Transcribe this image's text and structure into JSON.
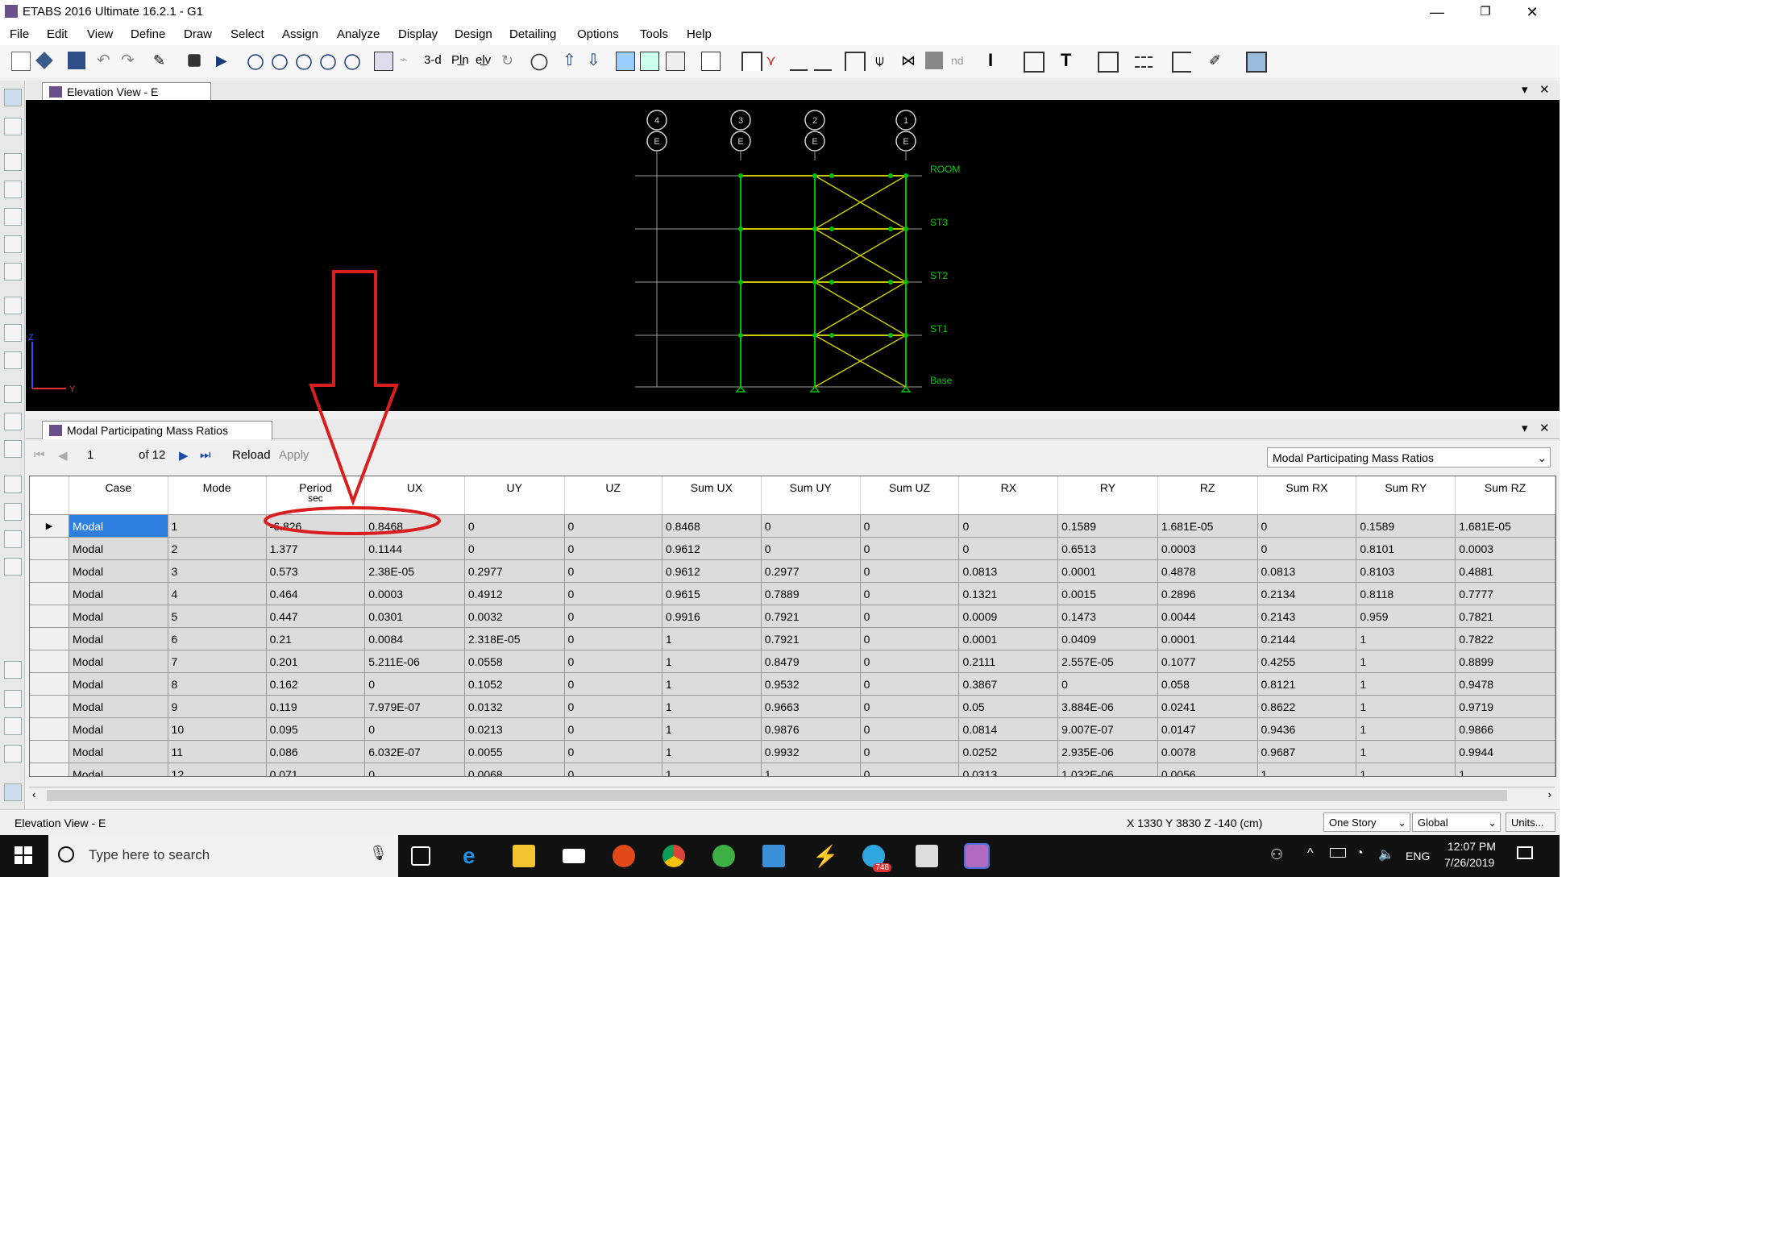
{
  "window": {
    "title": "ETABS 2016 Ultimate 16.2.1 - G1",
    "minimize": "—",
    "restore": "❐",
    "close": "✕"
  },
  "menu": [
    "File",
    "Edit",
    "View",
    "Define",
    "Draw",
    "Select",
    "Assign",
    "Analyze",
    "Display",
    "Design",
    "Detailing",
    "Options",
    "Tools",
    "Help"
  ],
  "toolbar": {
    "view3d_label": "3-d",
    "plan_label": "Pl̲n",
    "elev_label": "el̲v",
    "nd_label": "nd"
  },
  "elevation_panel": {
    "tab_label": "Elevation View - E",
    "grid_labels": [
      "4",
      "3",
      "2",
      "1"
    ],
    "grid_line_label": "E",
    "stories": [
      "ROOM",
      "ST3",
      "ST2",
      "ST1",
      "Base"
    ],
    "axis_z": "Z",
    "axis_y": "Y"
  },
  "table_panel": {
    "tab_label": "Modal Participating Mass Ratios",
    "nav": {
      "page": "1",
      "of_label": "of 12",
      "reload": "Reload",
      "apply": "Apply"
    },
    "table_select": "Modal Participating Mass Ratios",
    "columns": [
      {
        "label": "Case",
        "sub": ""
      },
      {
        "label": "Mode",
        "sub": ""
      },
      {
        "label": "Period",
        "sub": "sec"
      },
      {
        "label": "UX",
        "sub": ""
      },
      {
        "label": "UY",
        "sub": ""
      },
      {
        "label": "UZ",
        "sub": ""
      },
      {
        "label": "Sum UX",
        "sub": ""
      },
      {
        "label": "Sum UY",
        "sub": ""
      },
      {
        "label": "Sum UZ",
        "sub": ""
      },
      {
        "label": "RX",
        "sub": ""
      },
      {
        "label": "RY",
        "sub": ""
      },
      {
        "label": "RZ",
        "sub": ""
      },
      {
        "label": "Sum RX",
        "sub": ""
      },
      {
        "label": "Sum RY",
        "sub": ""
      },
      {
        "label": "Sum RZ",
        "sub": ""
      }
    ],
    "rows": [
      [
        "Modal",
        "1",
        "-6.826",
        "0.8468",
        "0",
        "0",
        "0.8468",
        "0",
        "0",
        "0",
        "0.1589",
        "1.681E-05",
        "0",
        "0.1589",
        "1.681E-05"
      ],
      [
        "Modal",
        "2",
        "1.377",
        "0.1144",
        "0",
        "0",
        "0.9612",
        "0",
        "0",
        "0",
        "0.6513",
        "0.0003",
        "0",
        "0.8101",
        "0.0003"
      ],
      [
        "Modal",
        "3",
        "0.573",
        "2.38E-05",
        "0.2977",
        "0",
        "0.9612",
        "0.2977",
        "0",
        "0.0813",
        "0.0001",
        "0.4878",
        "0.0813",
        "0.8103",
        "0.4881"
      ],
      [
        "Modal",
        "4",
        "0.464",
        "0.0003",
        "0.4912",
        "0",
        "0.9615",
        "0.7889",
        "0",
        "0.1321",
        "0.0015",
        "0.2896",
        "0.2134",
        "0.8118",
        "0.7777"
      ],
      [
        "Modal",
        "5",
        "0.447",
        "0.0301",
        "0.0032",
        "0",
        "0.9916",
        "0.7921",
        "0",
        "0.0009",
        "0.1473",
        "0.0044",
        "0.2143",
        "0.959",
        "0.7821"
      ],
      [
        "Modal",
        "6",
        "0.21",
        "0.0084",
        "2.318E-05",
        "0",
        "1",
        "0.7921",
        "0",
        "0.0001",
        "0.0409",
        "0.0001",
        "0.2144",
        "1",
        "0.7822"
      ],
      [
        "Modal",
        "7",
        "0.201",
        "5.211E-06",
        "0.0558",
        "0",
        "1",
        "0.8479",
        "0",
        "0.2111",
        "2.557E-05",
        "0.1077",
        "0.4255",
        "1",
        "0.8899"
      ],
      [
        "Modal",
        "8",
        "0.162",
        "0",
        "0.1052",
        "0",
        "1",
        "0.9532",
        "0",
        "0.3867",
        "0",
        "0.058",
        "0.8121",
        "1",
        "0.9478"
      ],
      [
        "Modal",
        "9",
        "0.119",
        "7.979E-07",
        "0.0132",
        "0",
        "1",
        "0.9663",
        "0",
        "0.05",
        "3.884E-06",
        "0.0241",
        "0.8622",
        "1",
        "0.9719"
      ],
      [
        "Modal",
        "10",
        "0.095",
        "0",
        "0.0213",
        "0",
        "1",
        "0.9876",
        "0",
        "0.0814",
        "9.007E-07",
        "0.0147",
        "0.9436",
        "1",
        "0.9866"
      ],
      [
        "Modal",
        "11",
        "0.086",
        "6.032E-07",
        "0.0055",
        "0",
        "1",
        "0.9932",
        "0",
        "0.0252",
        "2.935E-06",
        "0.0078",
        "0.9687",
        "1",
        "0.9944"
      ],
      [
        "Modal",
        "12",
        "0.071",
        "0",
        "0.0068",
        "0",
        "1",
        "1",
        "0",
        "0.0313",
        "1.032E-06",
        "0.0056",
        "1",
        "1",
        "1"
      ]
    ]
  },
  "statusbar": {
    "left": "Elevation View - E",
    "coords": "X 1330  Y 3830  Z -140 (cm)",
    "story_select": "One Story",
    "coord_select": "Global",
    "units_button": "Units..."
  },
  "taskbar": {
    "search_placeholder": "Type here to search",
    "language": "ENG",
    "time": "12:07 PM",
    "date": "7/26/2019",
    "telegram_badge": "748"
  },
  "colors": {
    "annotation": "#d81e1e",
    "frame_green": "#00c000",
    "brace_yellow": "#c8c800",
    "selection": "#2f7fe0"
  }
}
